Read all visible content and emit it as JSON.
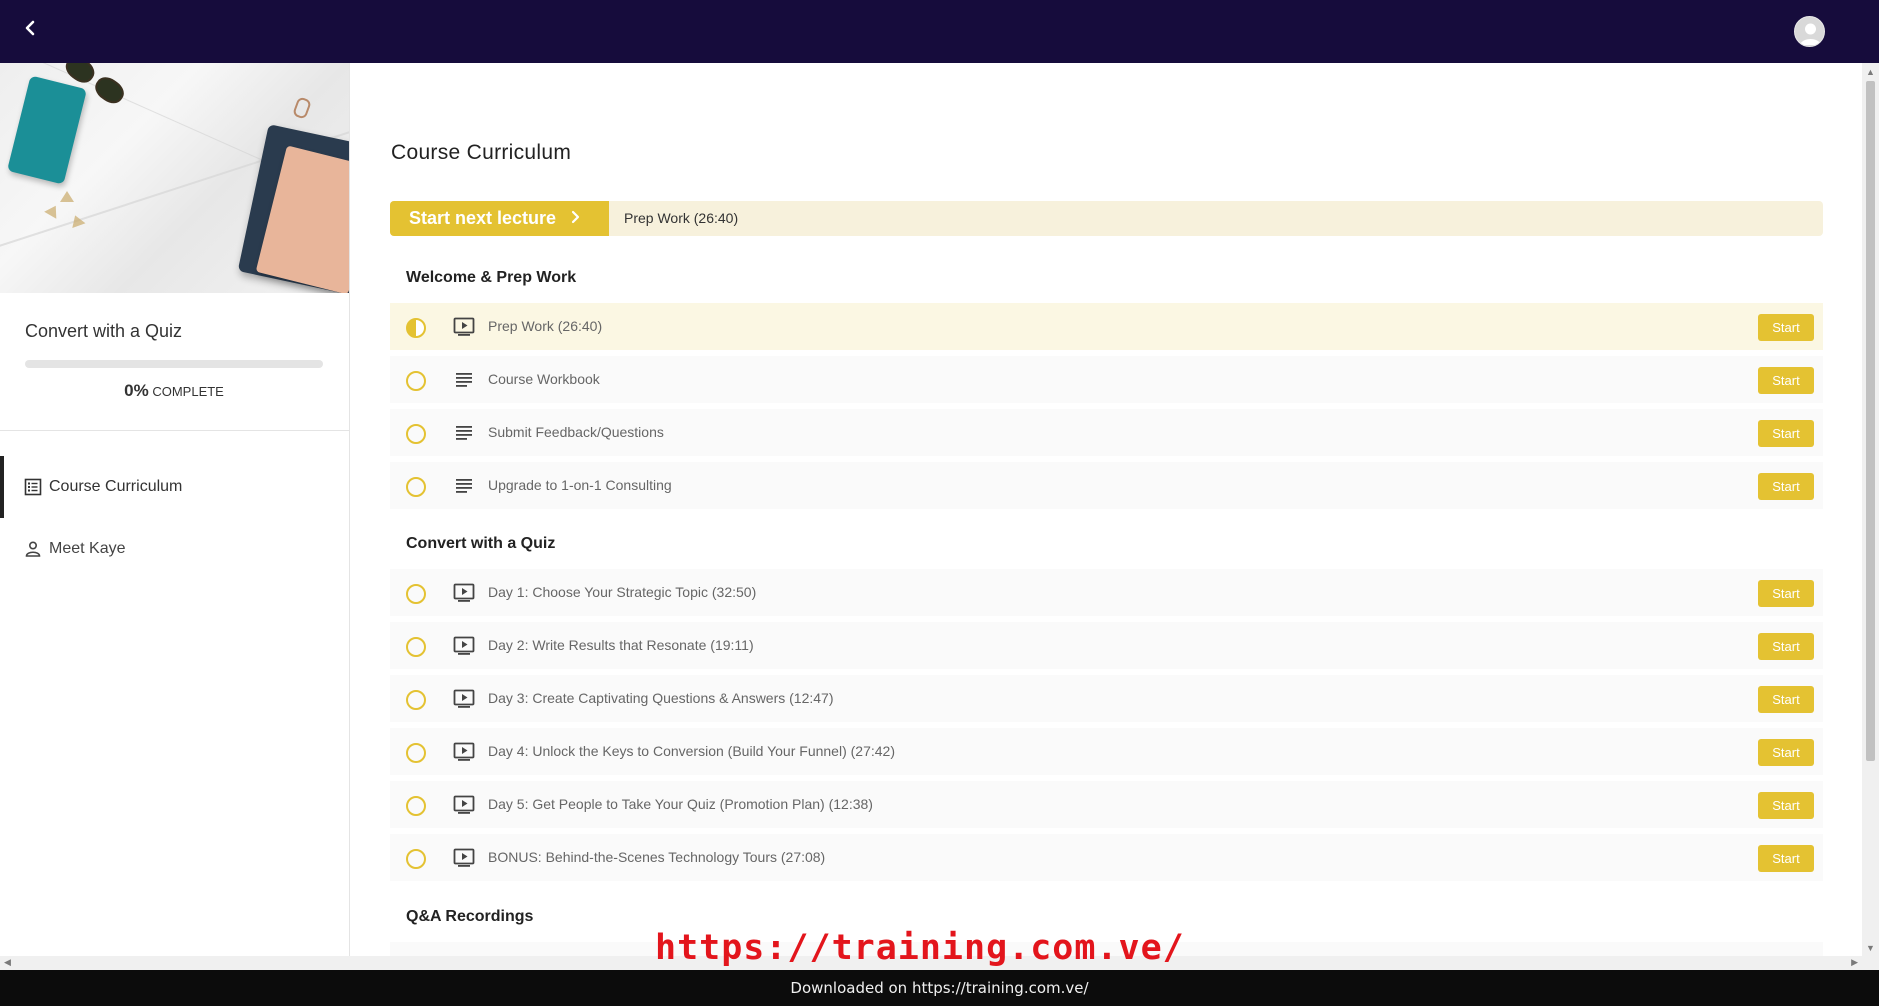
{
  "header": {
    "back_icon": "chevron-left-icon",
    "avatar_icon": "user-avatar"
  },
  "sidebar": {
    "course_title": "Convert with a Quiz",
    "progress_percent": 0,
    "progress_pct_label": "0%",
    "progress_suffix": "COMPLETE",
    "nav": [
      {
        "label": "Course Curriculum",
        "icon": "list-icon",
        "active": true
      },
      {
        "label": "Meet Kaye",
        "icon": "person-icon",
        "active": false
      }
    ]
  },
  "main": {
    "title": "Course Curriculum",
    "next_button_label": "Start next lecture",
    "next_lecture": "Prep Work (26:40)",
    "sections": [
      {
        "title": "Welcome & Prep Work",
        "lectures": [
          {
            "title": "Prep Work (26:40)",
            "type": "video",
            "status": "in-progress",
            "button": "Start"
          },
          {
            "title": "Course Workbook",
            "type": "text",
            "status": "not-started",
            "button": "Start"
          },
          {
            "title": "Submit Feedback/Questions",
            "type": "text",
            "status": "not-started",
            "button": "Start"
          },
          {
            "title": "Upgrade to 1-on-1 Consulting",
            "type": "text",
            "status": "not-started",
            "button": "Start"
          }
        ]
      },
      {
        "title": "Convert with a Quiz",
        "lectures": [
          {
            "title": "Day 1: Choose Your Strategic Topic (32:50)",
            "type": "video",
            "status": "not-started",
            "button": "Start"
          },
          {
            "title": "Day 2: Write Results that Resonate (19:11)",
            "type": "video",
            "status": "not-started",
            "button": "Start"
          },
          {
            "title": "Day 3: Create Captivating Questions & Answers (12:47)",
            "type": "video",
            "status": "not-started",
            "button": "Start"
          },
          {
            "title": "Day 4: Unlock the Keys to Conversion (Build Your Funnel) (27:42)",
            "type": "video",
            "status": "not-started",
            "button": "Start"
          },
          {
            "title": "Day 5: Get People to Take Your Quiz (Promotion Plan) (12:38)",
            "type": "video",
            "status": "not-started",
            "button": "Start"
          },
          {
            "title": "BONUS: Behind-the-Scenes Technology Tours (27:08)",
            "type": "video",
            "status": "not-started",
            "button": "Start"
          }
        ]
      },
      {
        "title": "Q&A Recordings",
        "lectures": []
      }
    ]
  },
  "watermark": "https://training.com.ve/",
  "footer": "Downloaded on https://training.com.ve/",
  "colors": {
    "topbar": "#160c3c",
    "accent": "#e4c232",
    "next_bar_bg": "#f7f1dc",
    "current_row_bg": "#fbf7e3"
  }
}
